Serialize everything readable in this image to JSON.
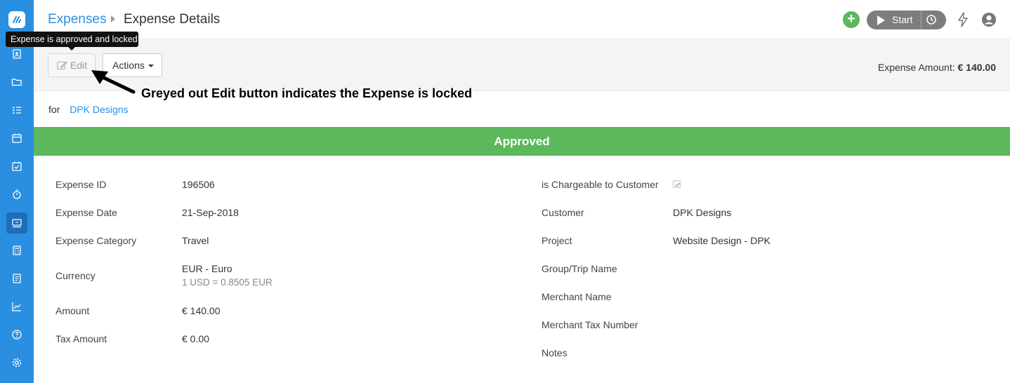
{
  "header": {
    "breadcrumb_link": "Expenses",
    "title": "Expense Details",
    "start_label": "Start"
  },
  "sidebar": {
    "items": [
      "logo-icon",
      "contacts-icon",
      "folder-icon",
      "tasks-icon",
      "calendar-icon",
      "calendar-check-icon",
      "stopwatch-icon",
      "expenses-icon",
      "calculator-icon",
      "invoice-icon",
      "reports-icon",
      "help-icon",
      "settings-icon"
    ],
    "active": "expenses-icon",
    "accent": "#2a8fe0"
  },
  "toolbar": {
    "edit_label": "Edit",
    "actions_label": "Actions",
    "amount_label": "Expense Amount:",
    "amount_value": "€ 140.00"
  },
  "tooltip": "Expense is approved and locked",
  "annotation": "Greyed out Edit button indicates the Expense is locked",
  "customer": {
    "for_label": "for",
    "name": "DPK Designs"
  },
  "status": {
    "label": "Approved",
    "color": "#5cb85c"
  },
  "details_left": {
    "expense_id_label": "Expense ID",
    "expense_id": "196506",
    "date_label": "Expense Date",
    "date": "21-Sep-2018",
    "category_label": "Expense Category",
    "category": "Travel",
    "currency_label": "Currency",
    "currency": "EUR - Euro",
    "rate": "1 USD = 0.8505 EUR",
    "amount_label": "Amount",
    "amount": "€ 140.00",
    "tax_label": "Tax Amount",
    "tax": "€ 0.00"
  },
  "details_right": {
    "chargeable_label": "is Chargeable to Customer",
    "chargeable": true,
    "customer_label": "Customer",
    "customer": "DPK Designs",
    "project_label": "Project",
    "project": "Website Design - DPK",
    "group_label": "Group/Trip Name",
    "merchant_label": "Merchant Name",
    "merchant_tax_label": "Merchant Tax Number",
    "notes_label": "Notes"
  }
}
